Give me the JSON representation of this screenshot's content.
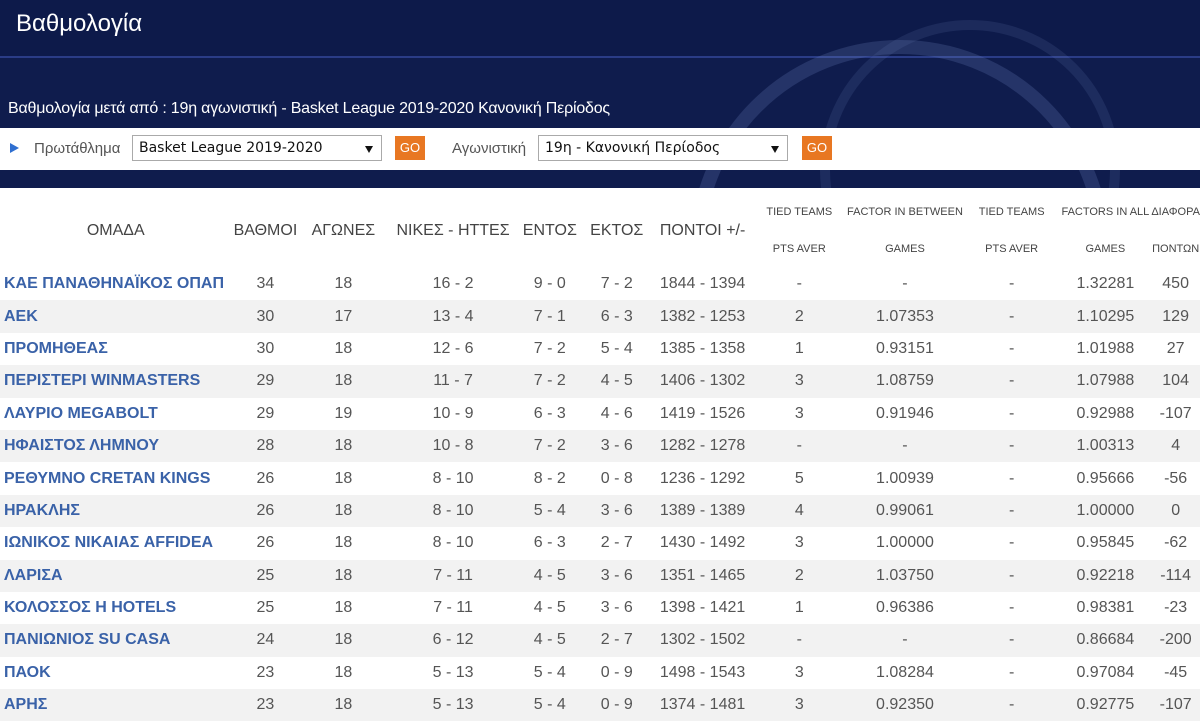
{
  "header": {
    "title": "Βαθμολογία",
    "subtitle": "Βαθμολογία μετά από : 19η αγωνιστική - Basket League 2019-2020 Κανονική Περίοδος"
  },
  "filters": {
    "championship_label": "Πρωτάθλημα",
    "championship_value": "Basket League 2019-2020",
    "round_label": "Αγωνιστική",
    "round_value": "19η - Κανονική Περίοδος",
    "go_label": "GO"
  },
  "table": {
    "headers": {
      "team": "ΟΜΑΔΑ",
      "points": "ΒΑΘΜΟΙ",
      "games": "ΑΓΩΝΕΣ",
      "wins_losses": "ΝΙΚΕΣ - ΗΤΤΕΣ",
      "home": "ΕΝΤΟΣ",
      "away": "ΕΚΤΟΣ",
      "score": "ΠΟΝΤΟΙ +/-",
      "tied_teams_1": "TIED TEAMS",
      "tied_teams_1b": "PTS AVER",
      "factor_between_1": "FACTOR IN BETWEEN",
      "factor_between_1b": "GAMES",
      "tied_teams_2": "TIED TEAMS",
      "tied_teams_2b": "PTS AVER",
      "factors_all_1": "FACTORS IN ALL",
      "factors_all_1b": "GAMES",
      "diff_1": "ΔΙΑΦΟΡΑ",
      "diff_1b": "ΠΟΝΤΩΝ"
    },
    "rows": [
      {
        "team": "ΚΑΕ ΠΑΝΑΘΗΝΑΪΚΟΣ ΟΠΑΠ",
        "points": "34",
        "games": "18",
        "wl": "16 - 2",
        "home": "9 - 0",
        "away": "7 - 2",
        "score": "1844 - 1394",
        "tied1": "-",
        "factor_between": "-",
        "tied2": "-",
        "factor_all": "1.32281",
        "diff": "450"
      },
      {
        "team": "ΑΕΚ",
        "points": "30",
        "games": "17",
        "wl": "13 - 4",
        "home": "7 - 1",
        "away": "6 - 3",
        "score": "1382 - 1253",
        "tied1": "2",
        "factor_between": "1.07353",
        "tied2": "-",
        "factor_all": "1.10295",
        "diff": "129"
      },
      {
        "team": "ΠΡΟΜΗΘΕΑΣ",
        "points": "30",
        "games": "18",
        "wl": "12 - 6",
        "home": "7 - 2",
        "away": "5 - 4",
        "score": "1385 - 1358",
        "tied1": "1",
        "factor_between": "0.93151",
        "tied2": "-",
        "factor_all": "1.01988",
        "diff": "27"
      },
      {
        "team": "ΠΕΡΙΣΤΕΡΙ WINMASTERS",
        "points": "29",
        "games": "18",
        "wl": "11 - 7",
        "home": "7 - 2",
        "away": "4 - 5",
        "score": "1406 - 1302",
        "tied1": "3",
        "factor_between": "1.08759",
        "tied2": "-",
        "factor_all": "1.07988",
        "diff": "104"
      },
      {
        "team": "ΛΑΥΡΙΟ MEGABOLT",
        "points": "29",
        "games": "19",
        "wl": "10 - 9",
        "home": "6 - 3",
        "away": "4 - 6",
        "score": "1419 - 1526",
        "tied1": "3",
        "factor_between": "0.91946",
        "tied2": "-",
        "factor_all": "0.92988",
        "diff": "-107"
      },
      {
        "team": "ΗΦΑΙΣΤΟΣ ΛΗΜΝΟΥ",
        "points": "28",
        "games": "18",
        "wl": "10 - 8",
        "home": "7 - 2",
        "away": "3 - 6",
        "score": "1282 - 1278",
        "tied1": "-",
        "factor_between": "-",
        "tied2": "-",
        "factor_all": "1.00313",
        "diff": "4"
      },
      {
        "team": "ΡΕΘΥΜΝΟ CRETAN KINGS",
        "points": "26",
        "games": "18",
        "wl": "8 - 10",
        "home": "8 - 2",
        "away": "0 - 8",
        "score": "1236 - 1292",
        "tied1": "5",
        "factor_between": "1.00939",
        "tied2": "-",
        "factor_all": "0.95666",
        "diff": "-56"
      },
      {
        "team": "ΗΡΑΚΛΗΣ",
        "points": "26",
        "games": "18",
        "wl": "8 - 10",
        "home": "5 - 4",
        "away": "3 - 6",
        "score": "1389 - 1389",
        "tied1": "4",
        "factor_between": "0.99061",
        "tied2": "-",
        "factor_all": "1.00000",
        "diff": "0"
      },
      {
        "team": "ΙΩΝΙΚΟΣ ΝΙΚΑΙΑΣ AFFIDEA",
        "points": "26",
        "games": "18",
        "wl": "8 - 10",
        "home": "6 - 3",
        "away": "2 - 7",
        "score": "1430 - 1492",
        "tied1": "3",
        "factor_between": "1.00000",
        "tied2": "-",
        "factor_all": "0.95845",
        "diff": "-62"
      },
      {
        "team": "ΛΑΡΙΣΑ",
        "points": "25",
        "games": "18",
        "wl": "7 - 11",
        "home": "4 - 5",
        "away": "3 - 6",
        "score": "1351 - 1465",
        "tied1": "2",
        "factor_between": "1.03750",
        "tied2": "-",
        "factor_all": "0.92218",
        "diff": "-114"
      },
      {
        "team": "ΚΟΛΟΣΣΟΣ H HOTELS",
        "points": "25",
        "games": "18",
        "wl": "7 - 11",
        "home": "4 - 5",
        "away": "3 - 6",
        "score": "1398 - 1421",
        "tied1": "1",
        "factor_between": "0.96386",
        "tied2": "-",
        "factor_all": "0.98381",
        "diff": "-23"
      },
      {
        "team": "ΠΑΝΙΩΝΙΟΣ SU CASA",
        "points": "24",
        "games": "18",
        "wl": "6 - 12",
        "home": "4 - 5",
        "away": "2 - 7",
        "score": "1302 - 1502",
        "tied1": "-",
        "factor_between": "-",
        "tied2": "-",
        "factor_all": "0.86684",
        "diff": "-200"
      },
      {
        "team": "ΠΑΟΚ",
        "points": "23",
        "games": "18",
        "wl": "5 - 13",
        "home": "5 - 4",
        "away": "0 - 9",
        "score": "1498 - 1543",
        "tied1": "3",
        "factor_between": "1.08284",
        "tied2": "-",
        "factor_all": "0.97084",
        "diff": "-45"
      },
      {
        "team": "ΑΡΗΣ",
        "points": "23",
        "games": "18",
        "wl": "5 - 13",
        "home": "5 - 4",
        "away": "0 - 9",
        "score": "1374 - 1481",
        "tied1": "3",
        "factor_between": "0.92350",
        "tied2": "-",
        "factor_all": "0.92775",
        "diff": "-107"
      }
    ]
  },
  "colors": {
    "header_bg": "#0f1c4d",
    "team_link": "#3a62a8",
    "go_button": "#e87722",
    "accent_arrow": "#2f6fd0"
  }
}
